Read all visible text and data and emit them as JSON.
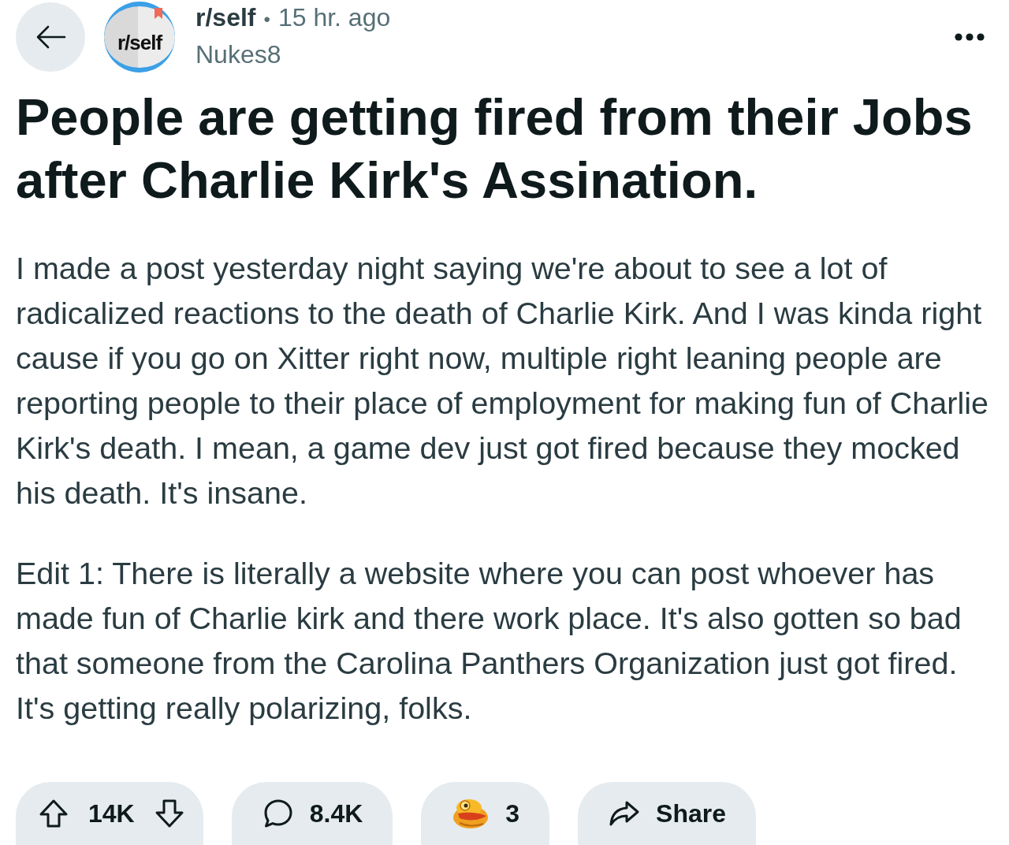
{
  "post": {
    "avatar_text": "r/self",
    "subreddit": "r/self",
    "separator": "•",
    "time": "15 hr. ago",
    "author": "Nukes8"
  },
  "title": "People are getting fired from their Jobs after Charlie Kirk's Assination.",
  "body": [
    "I made a post yesterday night saying we're about to see a lot of radicalized reactions to the death of Charlie Kirk. And I was kinda right cause if you go on Xitter right now, multiple right leaning people are reporting people to their place of employment for making fun of Charlie Kirk's death. I mean, a game dev just got fired because they mocked his death. It's insane.",
    "Edit 1: There is literally a website where you can post whoever has made fun of Charlie kirk and there work place. It's also gotten so bad that someone from the Carolina Panthers Organization just got fired. It's getting really polarizing, folks."
  ],
  "actions": [
    {
      "kind": "vote",
      "label": "14K"
    },
    {
      "kind": "comment",
      "label": "8.4K"
    },
    {
      "kind": "award",
      "label": "3"
    },
    {
      "kind": "share",
      "label": "Share"
    }
  ]
}
